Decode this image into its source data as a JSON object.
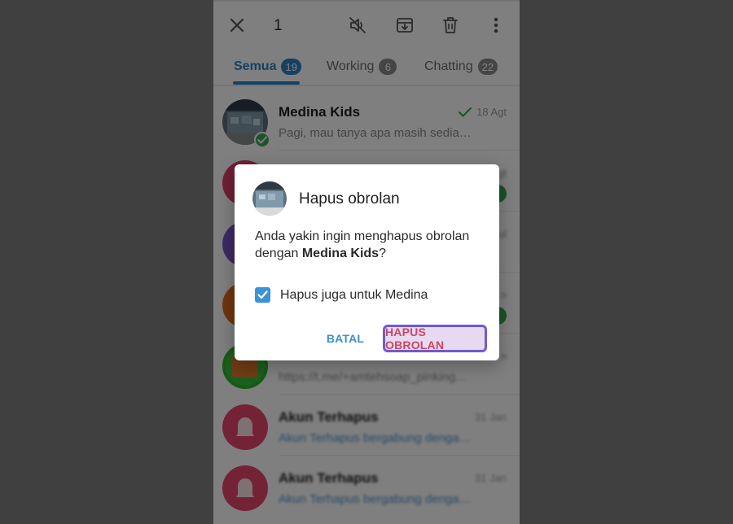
{
  "topbar": {
    "selected_count": "1",
    "icons": [
      "close-icon",
      "mute-icon",
      "archive-icon",
      "trash-icon",
      "more-vert-icon"
    ]
  },
  "tabs": [
    {
      "label": "Semua",
      "badge": "19",
      "active": true
    },
    {
      "label": "Working",
      "badge": "6",
      "active": false
    },
    {
      "label": "Chatting",
      "badge": "22",
      "active": false
    }
  ],
  "chats": [
    {
      "name": "Medina Kids",
      "preview": "Pagi, mau tanya apa masih sedia…",
      "time": "18 Agt",
      "avatar_color": "#6b7f8f"
    },
    {
      "name": "",
      "preview": "",
      "time": "gt",
      "avatar_color": "#e23f6a"
    },
    {
      "name": "",
      "preview": "",
      "time": "ul",
      "avatar_color": "#7a56c7"
    },
    {
      "name": "",
      "preview": "",
      "time": "n",
      "avatar_color": "#e36b1c"
    },
    {
      "name": "",
      "preview": "https://t.me/+amtehsoap_pinking…",
      "time": "n",
      "avatar_color": "#37c23c"
    },
    {
      "name": "Akun Terhapus",
      "preview": "Akun Terhapus bergabung denga…",
      "time": "31 Jan",
      "avatar_color": "#e8476f"
    },
    {
      "name": "Akun Terhapus",
      "preview": "Akun Terhapus bergabung denga…",
      "time": "31 Jan",
      "avatar_color": "#e8476f"
    }
  ],
  "dialog": {
    "title": "Hapus obrolan",
    "message_prefix": "Anda yakin ingin menghapus obrolan dengan ",
    "message_name": "Medina Kids",
    "message_suffix": "?",
    "checkbox_label": "Hapus juga untuk Medina",
    "checkbox_checked": true,
    "cancel_label": "BATAL",
    "confirm_label": "HAPUS OBROLAN"
  },
  "colors": {
    "accent": "#2a83c7",
    "danger": "#d0455e",
    "online": "#3aa655"
  }
}
